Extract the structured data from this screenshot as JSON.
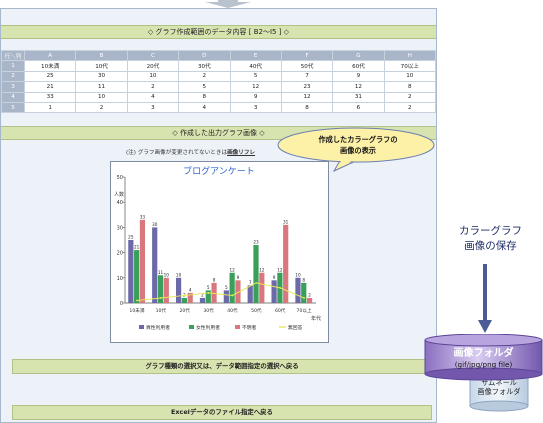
{
  "header_bar": "◇ グラフ作成範囲のデータ内容 [ B2〜I5 ] ◇",
  "table": {
    "corner": "行＼列",
    "cols": [
      "A",
      "B",
      "C",
      "D",
      "E",
      "F",
      "G",
      "H"
    ],
    "rows": [
      {
        "h": "1",
        "cells": [
          "10未満",
          "10代",
          "20代",
          "30代",
          "40代",
          "50代",
          "60代",
          "70以上"
        ]
      },
      {
        "h": "2",
        "cells": [
          "25",
          "30",
          "10",
          "2",
          "5",
          "7",
          "9",
          "10"
        ]
      },
      {
        "h": "3",
        "cells": [
          "21",
          "11",
          "2",
          "5",
          "12",
          "23",
          "12",
          "8"
        ]
      },
      {
        "h": "4",
        "cells": [
          "33",
          "10",
          "4",
          "8",
          "9",
          "12",
          "31",
          "2"
        ]
      },
      {
        "h": "5",
        "cells": [
          "1",
          "2",
          "3",
          "4",
          "3",
          "8",
          "6",
          "2"
        ]
      }
    ]
  },
  "image_bar": "◇ 作成した出力グラフ画像 ◇",
  "note_prefix": "(注) グラフ画像が変更されてないときは",
  "note_link": "画像リフレ",
  "callout": {
    "line1": "作成したカラーグラフの",
    "line2": "画像の表示"
  },
  "chart_data": {
    "type": "bar",
    "title": "ブログアンケート",
    "ylabel": "人数",
    "xlabel": "年代",
    "ylim": [
      0,
      50
    ],
    "yticks": [
      "0",
      "10",
      "20",
      "30",
      "40",
      "50"
    ],
    "categories": [
      "10未満",
      "10代",
      "20代",
      "30代",
      "40代",
      "50代",
      "60代",
      "70以上"
    ],
    "series": [
      {
        "name": "異性利用者",
        "color": "#6b69a8",
        "values": [
          25,
          30,
          10,
          2,
          5,
          7,
          9,
          10
        ]
      },
      {
        "name": "女性利用者",
        "color": "#3a9f58",
        "values": [
          21,
          11,
          2,
          5,
          12,
          23,
          12,
          8
        ]
      },
      {
        "name": "不明者",
        "color": "#d9777e",
        "values": [
          33,
          10,
          4,
          8,
          9,
          12,
          31,
          2
        ]
      },
      {
        "name": "無回答",
        "color": "#e8e85a",
        "values": [
          1,
          2,
          3,
          4,
          3,
          8,
          6,
          2
        ]
      }
    ]
  },
  "buttons": {
    "back_graph": "グラフ種類の選択又は、データ範囲指定の選択へ戻る",
    "back_excel": "Excelデータのファイル指定へ戻る"
  },
  "side": {
    "save_line1": "カラーグラフ",
    "save_line2": "画像の保存",
    "folder_label": "画像フォルダ",
    "folder_ext": "(gif/jpg/png file)",
    "thumb_line1": "サムネール",
    "thumb_line2": "画像フォルダ"
  }
}
